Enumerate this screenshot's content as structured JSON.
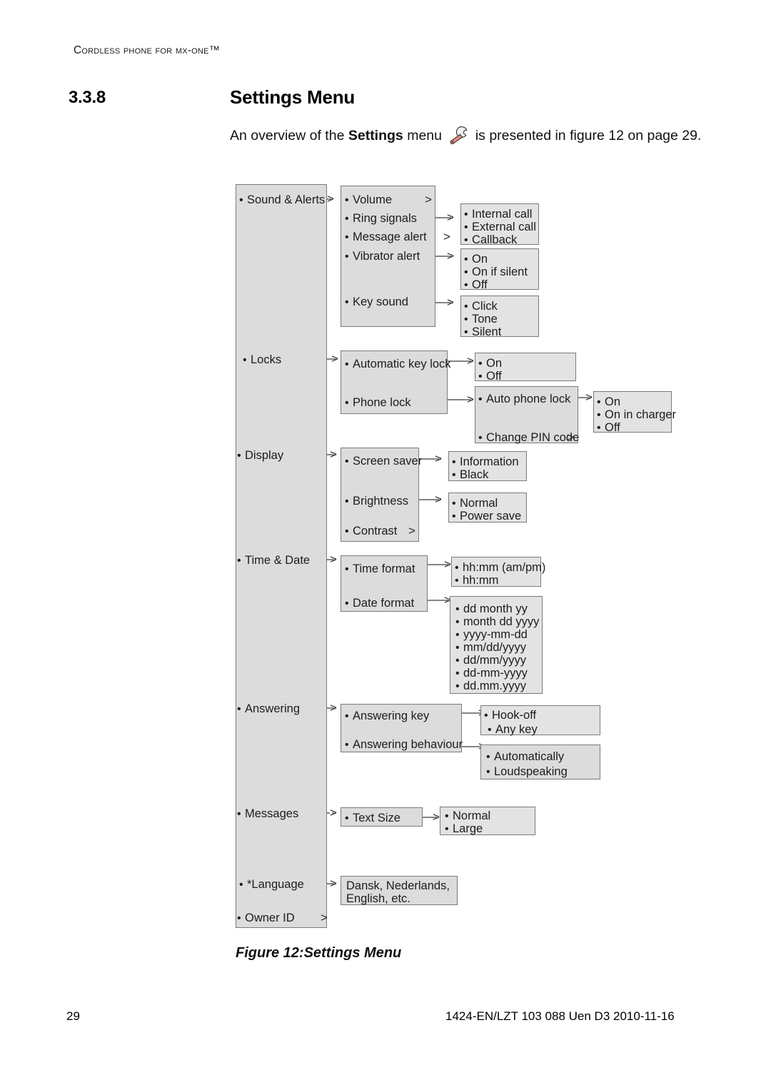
{
  "page": {
    "running_header": "Cordless Phone for MX-ONE™",
    "section_number": "3.3.8",
    "section_title": "Settings Menu",
    "intro_before": "An overview of the ",
    "intro_bold": "Settings",
    "intro_middle": " menu ",
    "intro_after": " is presented in figure 12 on page 29.",
    "wrench_icon": "wrench-icon",
    "figure_caption": "Figure 12:Settings Menu",
    "page_number": "29",
    "document_id": "1424-EN/LZT 103 088 Uen D3 2010-11-16"
  },
  "colors": {
    "box_fill": "#dcdcdc",
    "box_fill_light": "#e3e3e3",
    "box_border": "#7a7a7a",
    "text": "#1c1c1c",
    "wrench_handle": "#e8907a",
    "wrench_head": "#f2f2f2"
  },
  "chart_data": {
    "type": "diagram",
    "title": "Settings Menu",
    "root_label": "Settings",
    "level1": [
      "Sound & Alerts",
      "Locks",
      "Display",
      "Time & Date",
      "Answering",
      "Messages",
      "*Language",
      "Owner ID"
    ],
    "tree": [
      {
        "label": "Sound & Alerts",
        "children": [
          {
            "label": "Volume",
            "has_submenu": true,
            "children": []
          },
          {
            "label": "Ring signals",
            "has_submenu": true,
            "children": [
              {
                "label": "Internal call"
              },
              {
                "label": "External call"
              },
              {
                "label": "Callback"
              }
            ]
          },
          {
            "label": "Message alert",
            "has_submenu": true,
            "children": []
          },
          {
            "label": "Vibrator alert",
            "has_submenu": true,
            "children": [
              {
                "label": "On"
              },
              {
                "label": "On if silent"
              },
              {
                "label": "Off"
              }
            ]
          },
          {
            "label": "Key sound",
            "has_submenu": true,
            "children": [
              {
                "label": "Click"
              },
              {
                "label": "Tone"
              },
              {
                "label": "Silent"
              }
            ]
          }
        ]
      },
      {
        "label": "Locks",
        "children": [
          {
            "label": "Automatic key lock",
            "has_submenu": true,
            "children": [
              {
                "label": "On"
              },
              {
                "label": "Off"
              }
            ]
          },
          {
            "label": "Phone lock",
            "has_submenu": true,
            "children": [
              {
                "label": "Auto phone lock",
                "has_submenu": true,
                "children": [
                  {
                    "label": "On"
                  },
                  {
                    "label": "On in charger"
                  },
                  {
                    "label": "Off"
                  }
                ]
              },
              {
                "label": "Change PIN code",
                "has_submenu": true,
                "children": []
              }
            ]
          }
        ]
      },
      {
        "label": "Display",
        "children": [
          {
            "label": "Screen saver",
            "has_submenu": true,
            "children": [
              {
                "label": "Information"
              },
              {
                "label": "Black"
              }
            ]
          },
          {
            "label": "Brightness",
            "has_submenu": true,
            "children": [
              {
                "label": "Normal"
              },
              {
                "label": "Power save"
              }
            ]
          },
          {
            "label": "Contrast",
            "has_submenu": true,
            "children": []
          }
        ]
      },
      {
        "label": "Time & Date",
        "children": [
          {
            "label": "Time format",
            "has_submenu": true,
            "children": [
              {
                "label": "hh:mm (am/pm)"
              },
              {
                "label": "hh:mm"
              }
            ]
          },
          {
            "label": "Date format",
            "has_submenu": true,
            "children": [
              {
                "label": "dd month yy"
              },
              {
                "label": "month dd yyyy"
              },
              {
                "label": "yyyy-mm-dd"
              },
              {
                "label": "mm/dd/yyyy"
              },
              {
                "label": "dd/mm/yyyy"
              },
              {
                "label": "dd-mm-yyyy"
              },
              {
                "label": "dd.mm.yyyy"
              }
            ]
          }
        ]
      },
      {
        "label": "Answering",
        "children": [
          {
            "label": "Answering key",
            "has_submenu": true,
            "children": [
              {
                "label": "Hook-off"
              },
              {
                "label": "Any key"
              }
            ]
          },
          {
            "label": "Answering behaviour",
            "has_submenu": true,
            "children": [
              {
                "label": "Automatically"
              },
              {
                "label": "Loudspeaking"
              }
            ]
          }
        ]
      },
      {
        "label": "Messages",
        "children": [
          {
            "label": "Text Size",
            "has_submenu": true,
            "children": [
              {
                "label": "Normal"
              },
              {
                "label": "Large"
              }
            ]
          }
        ]
      },
      {
        "label": "*Language",
        "children": [
          {
            "label": "Dansk, Nederlands, English, etc."
          }
        ]
      },
      {
        "label": "Owner ID",
        "has_submenu": true,
        "children": []
      }
    ],
    "labels": {
      "col1": {
        "sound_alerts": "Sound & Alerts",
        "locks": "Locks",
        "display": "Display",
        "time_date": "Time & Date",
        "answering": "Answering",
        "messages": "Messages",
        "language": "*Language",
        "owner_id": "Owner ID"
      },
      "col2": {
        "volume": "Volume",
        "ring_signals": "Ring signals",
        "message_alert": "Message alert",
        "vibrator_alert": "Vibrator alert",
        "key_sound": "Key sound",
        "auto_key_lock": "Automatic key lock",
        "phone_lock": "Phone lock",
        "screen_saver": "Screen saver",
        "brightness": "Brightness",
        "contrast": "Contrast",
        "time_format": "Time format",
        "date_format": "Date format",
        "answering_key": "Answering key",
        "answering_behaviour": "Answering behaviour",
        "text_size": "Text Size",
        "language_values_l1": "Dansk, Nederlands,",
        "language_values_l2": "English, etc."
      },
      "col3": {
        "internal_call": "Internal call",
        "external_call": "External call",
        "callback": "Callback",
        "vib_on": "On",
        "vib_on_if_silent": "On if silent",
        "vib_off": "Off",
        "click": "Click",
        "tone": "Tone",
        "silent": "Silent",
        "akl_on": "On",
        "akl_off": "Off",
        "auto_phone_lock": "Auto phone lock",
        "change_pin_code": "Change PIN code",
        "information": "Information",
        "black": "Black",
        "br_normal": "Normal",
        "power_save": "Power save",
        "tf_ampm": "hh:mm (am/pm)",
        "tf_hhmm": "hh:mm",
        "df_1": "dd month yy",
        "df_2": "month dd yyyy",
        "df_3": "yyyy-mm-dd",
        "df_4": "mm/dd/yyyy",
        "df_5": "dd/mm/yyyy",
        "df_6": "dd-mm-yyyy",
        "df_7": "dd.mm.yyyy",
        "hook_off": "Hook-off",
        "any_key": "Any key",
        "automatically": "Automatically",
        "loudspeaking": "Loudspeaking",
        "ts_normal": "Normal",
        "ts_large": "Large"
      },
      "col4": {
        "apl_on": "On",
        "apl_on_in_charger": "On in charger",
        "apl_off": "Off"
      },
      "submenu_caret": ">"
    }
  }
}
